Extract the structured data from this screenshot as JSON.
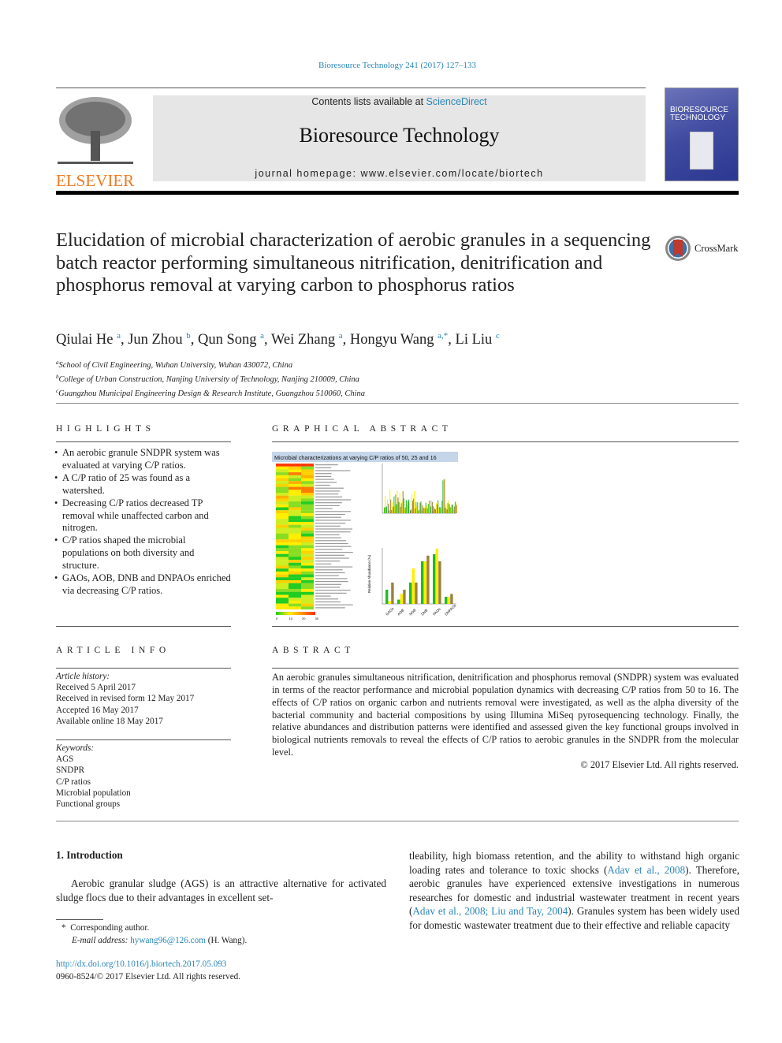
{
  "journal_ref": "Bioresource Technology 241 (2017) 127–133",
  "masthead": {
    "publisher": "ELSEVIER",
    "contents_prefix": "Contents lists available at ",
    "contents_link": "ScienceDirect",
    "journal_name": "Bioresource Technology",
    "homepage": "journal homepage: www.elsevier.com/locate/biortech",
    "cover_title": "BIORESOURCE TECHNOLOGY"
  },
  "article": {
    "title": "Elucidation of microbial characterization of aerobic granules in a sequencing batch reactor performing simultaneous nitrification, denitrification and phosphorus removal at varying carbon to phosphorus ratios",
    "crossmark": "CrossMark",
    "authors": [
      {
        "name": "Qiulai He",
        "sup": "a",
        "sep": ", "
      },
      {
        "name": "Jun Zhou",
        "sup": "b",
        "sep": ", "
      },
      {
        "name": "Qun Song",
        "sup": "a",
        "sep": ", "
      },
      {
        "name": "Wei Zhang",
        "sup": "a",
        "sep": ", "
      },
      {
        "name": "Hongyu Wang",
        "sup": "a,*",
        "sep": ", "
      },
      {
        "name": "Li Liu",
        "sup": "c",
        "sep": ""
      }
    ],
    "affiliations": [
      {
        "sup": "a",
        "text": "School of Civil Engineering, Wuhan University, Wuhan 430072, China"
      },
      {
        "sup": "b",
        "text": "College of Urban Construction, Nanjing University of Technology, Nanjing 210009, China"
      },
      {
        "sup": "c",
        "text": "Guangzhou Municipal Engineering Design & Research Institute, Guangzhou 510060, China"
      }
    ]
  },
  "highlights": {
    "heading": "HIGHLIGHTS",
    "items": [
      "An aerobic granule SNDPR system was evaluated at varying C/P ratios.",
      "A C/P ratio of 25 was found as a watershed.",
      "Decreasing C/P ratios decreased TP removal while unaffected carbon and nitrogen.",
      "C/P ratios shaped the microbial populations on both diversity and structure.",
      "GAOs, AOB, DNB and DNPAOs enriched via decreasing C/P ratios."
    ]
  },
  "graphical_abstract": {
    "heading": "GRAPHICAL ABSTRACT",
    "figure_title": "Microbial characterizations at varying C/P ratios of 50, 25 and 16",
    "colorbar_ticks": [
      "0",
      "10",
      "20",
      "30"
    ],
    "y_label": "Relative Abundance (%)",
    "groups": [
      "GAOs",
      "AOB",
      "NOB",
      "DNB",
      "PAOs",
      "DNPAOs"
    ],
    "colors": {
      "cp50": "#22bb22",
      "cp25": "#ffee00",
      "cp16": "#9a8040"
    }
  },
  "article_info": {
    "heading": "ARTICLE INFO",
    "history_label": "Article history:",
    "history": [
      "Received 5 April 2017",
      "Received in revised form 12 May 2017",
      "Accepted 16 May 2017",
      "Available online 18 May 2017"
    ],
    "keywords_label": "Keywords:",
    "keywords": [
      "AGS",
      "SNDPR",
      "C/P ratios",
      "Microbial population",
      "Functional groups"
    ]
  },
  "abstract": {
    "heading": "ABSTRACT",
    "text": "An aerobic granules simultaneous nitrification, denitrification and phosphorus removal (SNDPR) system was evaluated in terms of the reactor performance and microbial population dynamics with decreasing C/P ratios from 50 to 16. The effects of C/P ratios on organic carbon and nutrients removal were investigated, as well as the alpha diversity of the bacterial community and bacterial compositions by using Illumina MiSeq pyrosequencing technology. Finally, the relative abundances and distribution patterns were identified and assessed given the key functional groups involved in biological nutrients removals to reveal the effects of C/P ratios to aerobic granules in the SNDPR from the molecular level.",
    "copyright": "© 2017 Elsevier Ltd. All rights reserved."
  },
  "intro": {
    "heading": "1. Introduction",
    "left_text": "Aerobic granular sludge (AGS) is an attractive alternative for activated sludge flocs due to their advantages in excellent set-",
    "right_parts": [
      {
        "t": "tleability, high biomass retention, and the ability to withstand high organic loading rates and tolerance to toxic shocks (",
        "link": false
      },
      {
        "t": "Adav et al., 2008",
        "link": true
      },
      {
        "t": "). Therefore, aerobic granules have experienced extensive investigations in numerous researches for domestic and industrial wastewater treatment in recent years (",
        "link": false
      },
      {
        "t": "Adav et al., 2008; Liu and Tay, 2004",
        "link": true
      },
      {
        "t": "). Granules system has been widely used for domestic wastewater treatment due to their effective and reliable capacity",
        "link": false
      }
    ]
  },
  "footnotes": {
    "star": "*",
    "corresponding": "Corresponding author.",
    "email_label": "E-mail address:",
    "email": "hywang96@126.com",
    "email_suffix": " (H. Wang).",
    "doi": "http://dx.doi.org/10.1016/j.biortech.2017.05.093",
    "issn": "0960-8524/© 2017 Elsevier Ltd. All rights reserved."
  }
}
